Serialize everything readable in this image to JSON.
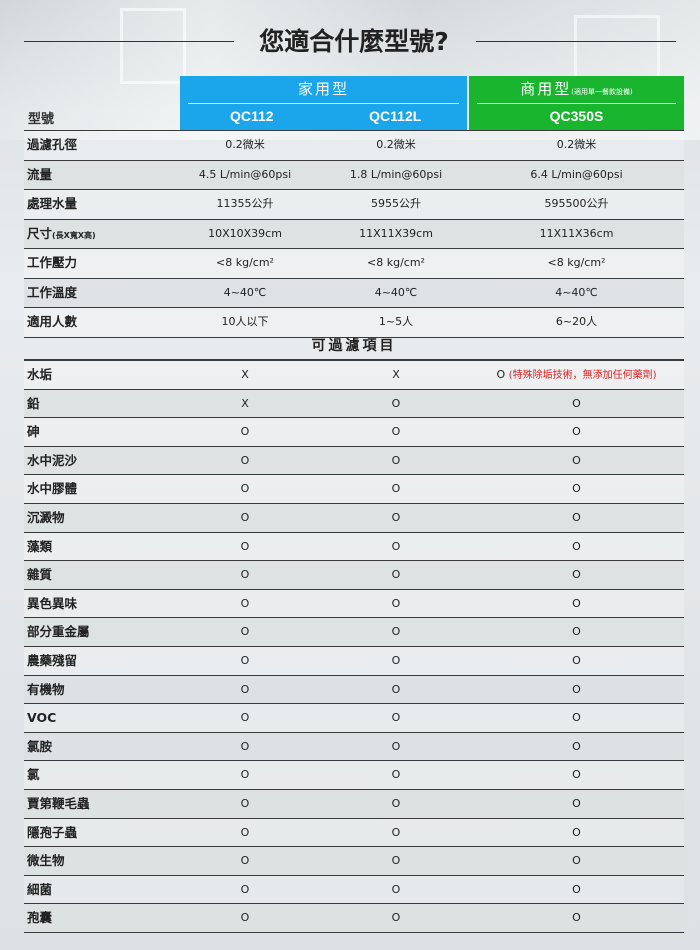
{
  "title": "您適合什麼型號?",
  "header": {
    "home_group": "家用型",
    "biz_group": "商用型",
    "biz_note": "(適用單一餐飲設備)",
    "model_label": "型號",
    "models": [
      "QC112",
      "QC112L",
      "QC350S"
    ]
  },
  "specs": [
    {
      "label": "過濾孔徑",
      "note": "",
      "values": [
        "0.2微米",
        "0.2微米",
        "0.2微米"
      ]
    },
    {
      "label": "流量",
      "note": "",
      "values": [
        "4.5 L/min@60psi",
        "1.8 L/min@60psi",
        "6.4 L/min@60psi"
      ]
    },
    {
      "label": "處理水量",
      "note": "",
      "values": [
        "11355公升",
        "5955公升",
        "595500公升"
      ]
    },
    {
      "label": "尺寸",
      "note": "(長X寬X高)",
      "values": [
        "10X10X39cm",
        "11X11X39cm",
        "11X11X36cm"
      ]
    },
    {
      "label": "工作壓力",
      "note": "",
      "values": [
        "<8 kg/cm²",
        "<8 kg/cm²",
        "<8 kg/cm²"
      ]
    },
    {
      "label": "工作溫度",
      "note": "",
      "values": [
        "4~40℃",
        "4~40℃",
        "4~40℃"
      ]
    },
    {
      "label": "適用人數",
      "note": "",
      "values": [
        "10人以下",
        "1~5人",
        "6~20人"
      ]
    }
  ],
  "section_title": "可過濾項目",
  "filters": [
    {
      "label": "水垢",
      "values": [
        "X",
        "X",
        "O"
      ],
      "note": "(特殊除垢技術，無添加任何藥劑)"
    },
    {
      "label": "鉛",
      "values": [
        "X",
        "O",
        "O"
      ],
      "note": ""
    },
    {
      "label": "砷",
      "values": [
        "O",
        "O",
        "O"
      ],
      "note": ""
    },
    {
      "label": "水中泥沙",
      "values": [
        "O",
        "O",
        "O"
      ],
      "note": ""
    },
    {
      "label": "水中膠體",
      "values": [
        "O",
        "O",
        "O"
      ],
      "note": ""
    },
    {
      "label": "沉澱物",
      "values": [
        "O",
        "O",
        "O"
      ],
      "note": ""
    },
    {
      "label": "藻類",
      "values": [
        "O",
        "O",
        "O"
      ],
      "note": ""
    },
    {
      "label": "雜質",
      "values": [
        "O",
        "O",
        "O"
      ],
      "note": ""
    },
    {
      "label": "異色異味",
      "values": [
        "O",
        "O",
        "O"
      ],
      "note": ""
    },
    {
      "label": "部分重金屬",
      "values": [
        "O",
        "O",
        "O"
      ],
      "note": ""
    },
    {
      "label": "農藥殘留",
      "values": [
        "O",
        "O",
        "O"
      ],
      "note": ""
    },
    {
      "label": "有機物",
      "values": [
        "O",
        "O",
        "O"
      ],
      "note": ""
    },
    {
      "label": "VOC",
      "values": [
        "O",
        "O",
        "O"
      ],
      "note": ""
    },
    {
      "label": "氯胺",
      "values": [
        "O",
        "O",
        "O"
      ],
      "note": ""
    },
    {
      "label": "氯",
      "values": [
        "O",
        "O",
        "O"
      ],
      "note": ""
    },
    {
      "label": "賈第鞭毛蟲",
      "values": [
        "O",
        "O",
        "O"
      ],
      "note": ""
    },
    {
      "label": "隱孢子蟲",
      "values": [
        "O",
        "O",
        "O"
      ],
      "note": ""
    },
    {
      "label": "微生物",
      "values": [
        "O",
        "O",
        "O"
      ],
      "note": ""
    },
    {
      "label": "細菌",
      "values": [
        "O",
        "O",
        "O"
      ],
      "note": ""
    },
    {
      "label": "孢囊",
      "values": [
        "O",
        "O",
        "O"
      ],
      "note": ""
    }
  ],
  "colors": {
    "home": "#1ba6ec",
    "biz": "#19b52e",
    "note_red": "#e02020"
  }
}
